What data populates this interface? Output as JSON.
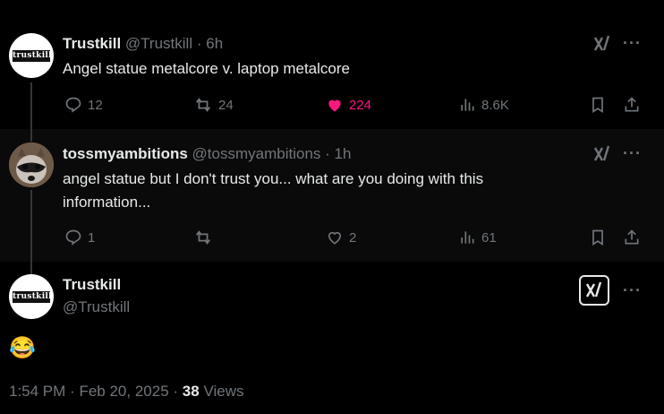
{
  "tweet1": {
    "name": "Trustkill",
    "handle": "@Trustkill",
    "dot": "·",
    "time": "6h",
    "text": "Angel statue metalcore v. laptop metalcore",
    "replies": "12",
    "retweets": "24",
    "likes": "224",
    "views": "8.6K",
    "avatar_text": "trustkill"
  },
  "tweet2": {
    "name": "tossmyambitions",
    "handle": "@tossmyambitions",
    "dot": "·",
    "time": "1h",
    "text": "angel statue but I don't trust you... what are you doing with this information...",
    "replies": "1",
    "likes": "2",
    "views": "61"
  },
  "tweet3": {
    "name": "Trustkill",
    "handle": "@Trustkill",
    "text": "😂",
    "time": "1:54 PM",
    "dot1": "·",
    "date": "Feb 20, 2025",
    "dot2": "·",
    "views_count": "38",
    "views_label": "Views",
    "avatar_text": "trustkill"
  },
  "colors": {
    "like_pink": "#f91880",
    "muted": "#71767b",
    "text": "#e7e9ea"
  }
}
